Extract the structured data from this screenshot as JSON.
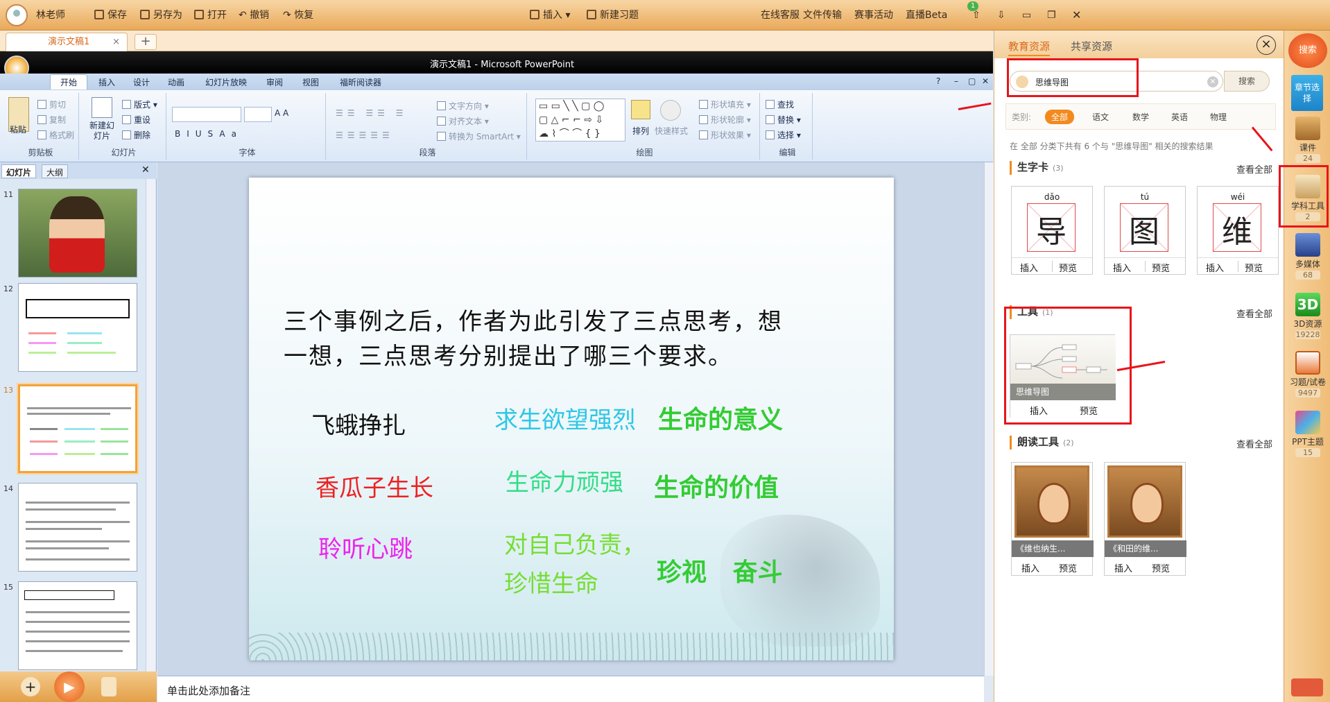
{
  "topbar": {
    "user": "林老师",
    "save": "保存",
    "save_as": "另存为",
    "open": "打开",
    "undo": "撤销",
    "redo": "恢复",
    "insert": "插入",
    "new_exercise": "新建习题",
    "online_support": "在线客服",
    "badge_count": "1",
    "file_transfer": "文件传输",
    "contest": "赛事活动",
    "live": "直播Beta"
  },
  "tabs": {
    "doc": "演示文稿1",
    "close": "×",
    "add": "+"
  },
  "ppt": {
    "window_title": "演示文稿1 - Microsoft PowerPoint",
    "ribbon_tabs": [
      "开始",
      "插入",
      "设计",
      "动画",
      "幻灯片放映",
      "审阅",
      "视图",
      "福昕阅读器"
    ],
    "groups": {
      "clipboard": {
        "label": "剪贴板",
        "paste": "粘贴",
        "cut": "剪切",
        "copy": "复制",
        "format_painter": "格式刷"
      },
      "slides": {
        "label": "幻灯片",
        "new_slide": "新建幻灯片",
        "layout": "版式",
        "reset": "重设",
        "delete": "删除"
      },
      "font": {
        "label": "字体"
      },
      "paragraph": {
        "label": "段落",
        "text_direction": "文字方向",
        "align_text": "对齐文本",
        "smartart": "转换为 SmartArt"
      },
      "drawing": {
        "label": "绘图",
        "arrange": "排列",
        "quick_styles": "快速样式",
        "shape_fill": "形状填充",
        "shape_outline": "形状轮廓",
        "shape_effects": "形状效果"
      },
      "editing": {
        "label": "编辑",
        "find": "查找",
        "replace": "替换",
        "select": "选择"
      }
    },
    "pane_tabs": {
      "slides": "幻灯片",
      "outline": "大纲"
    },
    "slide_numbers": [
      "11",
      "12",
      "13",
      "14",
      "15"
    ],
    "notes_placeholder": "单击此处添加备注"
  },
  "slide": {
    "question_line1": "三个事例之后，作者为此引发了三点思考，想",
    "question_line2": "一想，三点思考分别提出了哪三个要求。",
    "rows": [
      [
        "飞蛾挣扎",
        "求生欲望强烈",
        "生命的意义"
      ],
      [
        "香瓜子生长",
        "生命力顽强",
        "生命的价值"
      ],
      [
        "聆听心跳",
        "对自己负责，\n珍惜生命",
        "珍视   奋斗"
      ]
    ],
    "colors": {
      "r1c1": "#111111",
      "r1c2": "#2ec7e6",
      "r1c3": "#33cc33",
      "r2c1": "#ee2222",
      "r2c2": "#33dd88",
      "r2c3": "#33cc33",
      "r3c1": "#ee22ee",
      "r3c2": "#77dd33",
      "r3c3": "#33cc33"
    }
  },
  "panel": {
    "tab_edu": "教育资源",
    "tab_share": "共享资源",
    "close": "×",
    "search_value": "思维导图",
    "search_button": "搜索",
    "category_label": "类别:",
    "categories": [
      "全部",
      "语文",
      "数学",
      "英语",
      "物理"
    ],
    "result_info": "在 全部 分类下共有 6 个与 \"思维导图\" 相关的搜索结果",
    "view_all": "查看全部",
    "insert": "插入",
    "preview": "预览",
    "sections": {
      "char_cards": {
        "title": "生字卡",
        "count": "(3)"
      },
      "tools": {
        "title": "工具",
        "count": "(1)"
      },
      "reading": {
        "title": "朗读工具",
        "count": "(2)"
      }
    },
    "char_cards": [
      {
        "pinyin": "dǎo",
        "char": "导"
      },
      {
        "pinyin": "tú",
        "char": "图"
      },
      {
        "pinyin": "wéi",
        "char": "维"
      }
    ],
    "tool_name": "思维导图",
    "reading_items": [
      "《维也纳生...",
      "《和田的维..."
    ]
  },
  "sidebar": {
    "search": "搜索",
    "chapter": "章节选择",
    "items": [
      {
        "label": "课件",
        "count": "24"
      },
      {
        "label": "学科工具",
        "count": "2"
      },
      {
        "label": "多媒体",
        "count": "68"
      },
      {
        "label": "3D资源",
        "count": "19228"
      },
      {
        "label": "习题/试卷",
        "count": "9497"
      },
      {
        "label": "PPT主题",
        "count": "15"
      }
    ]
  }
}
